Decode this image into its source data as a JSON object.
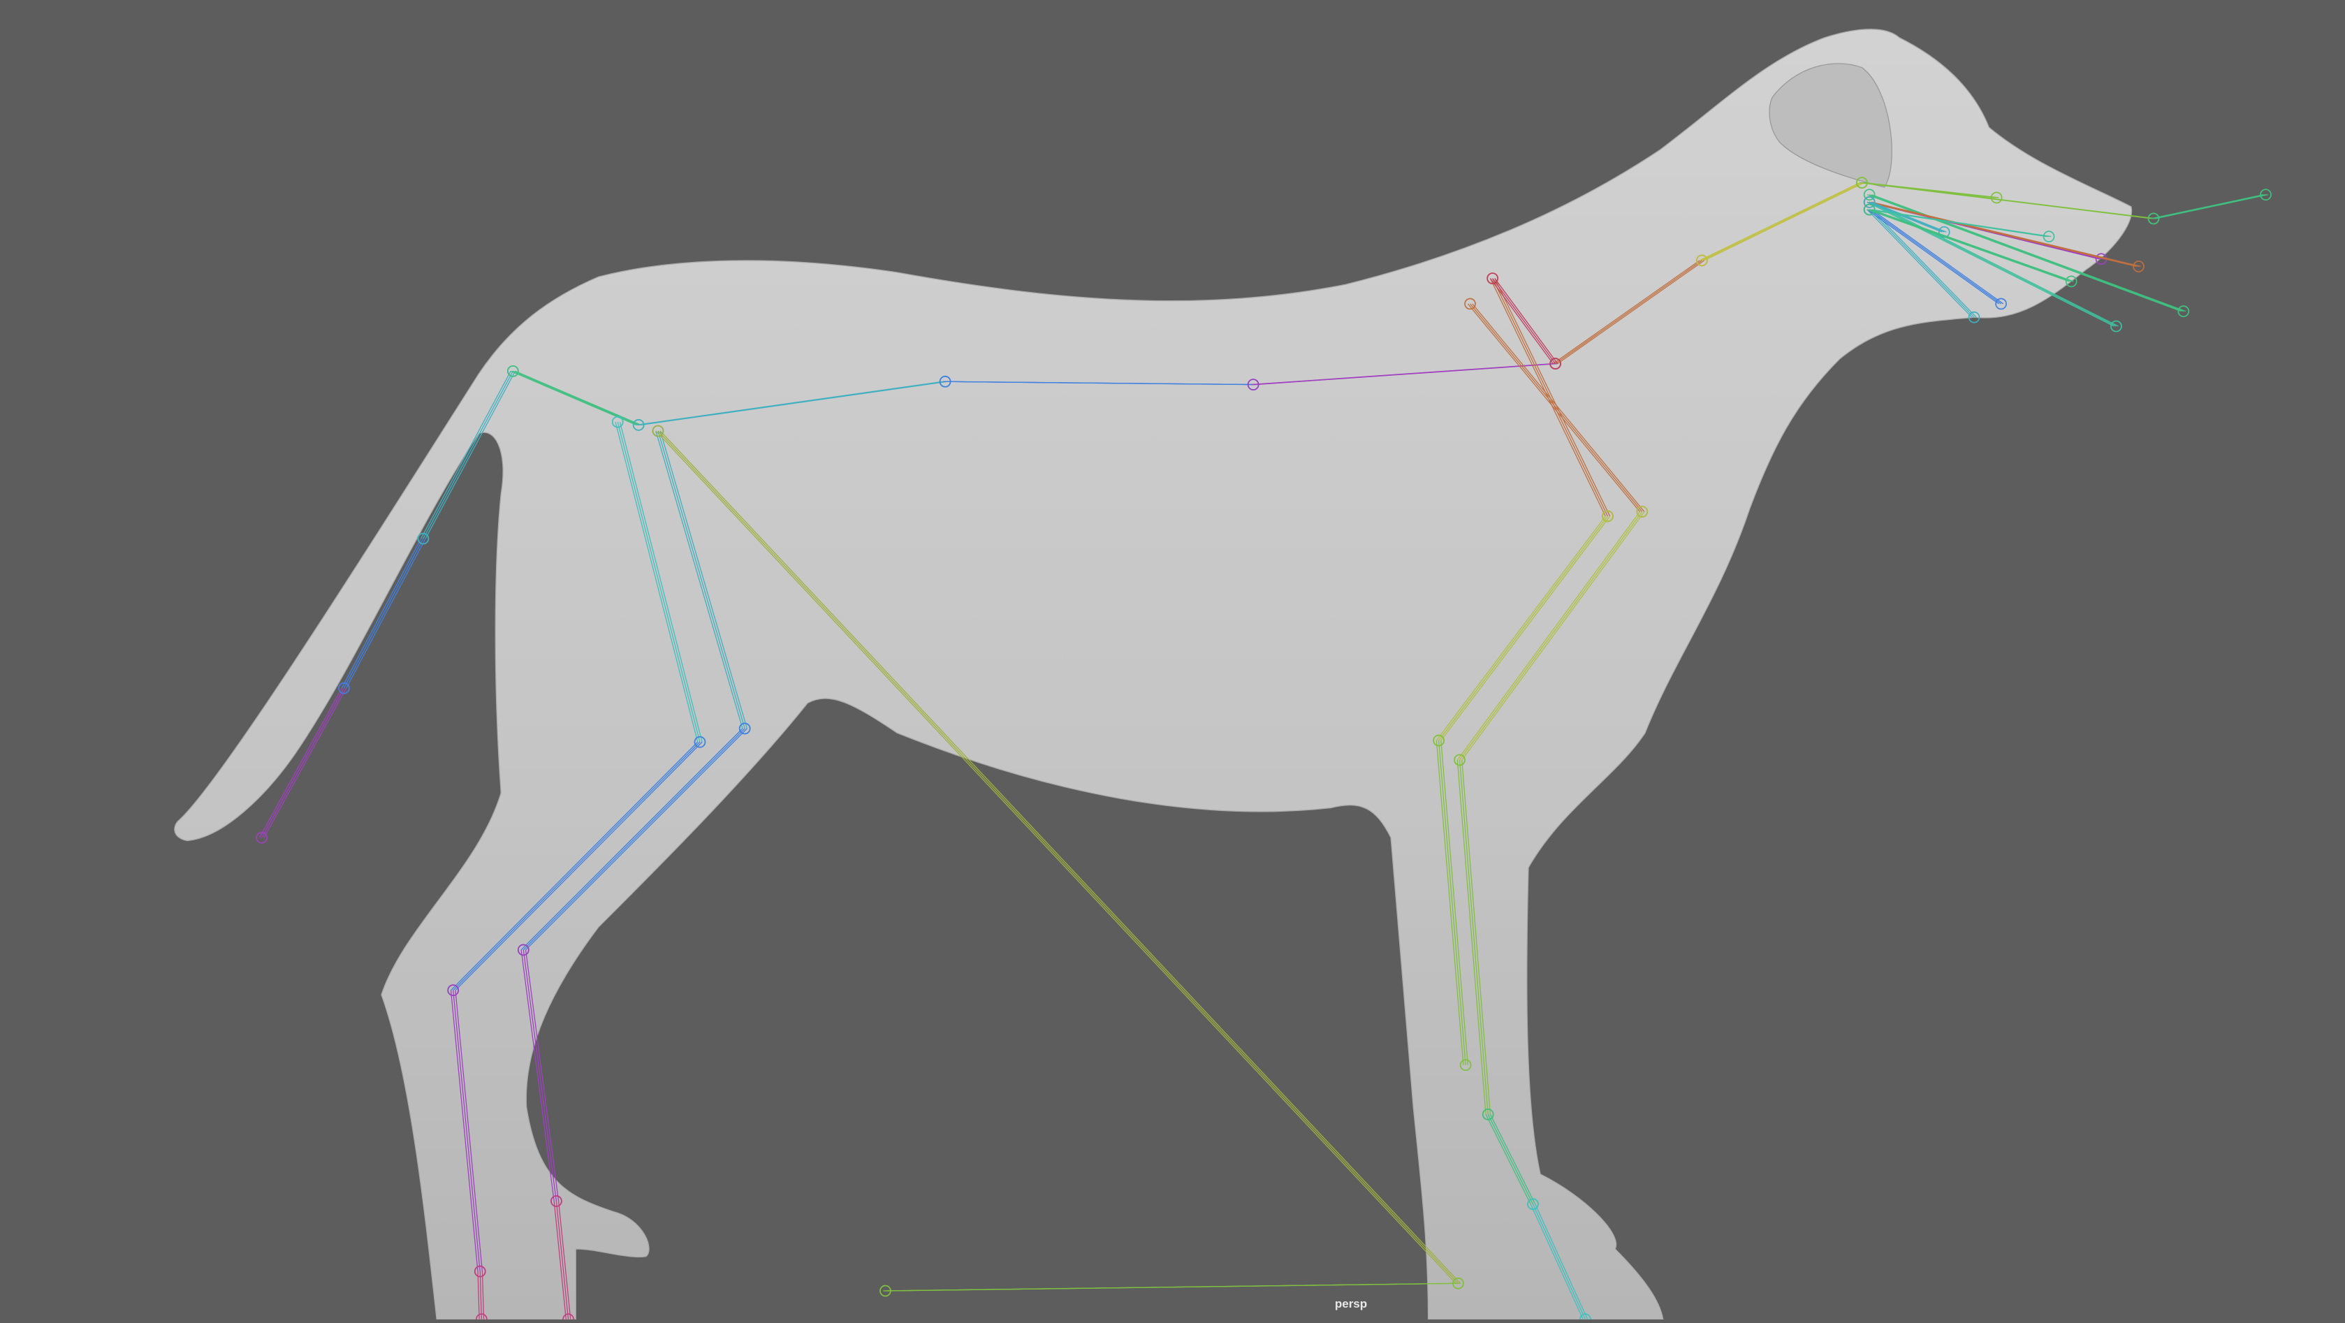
{
  "viewport": {
    "camera_label": "persp",
    "background_color": "#5d5d5d",
    "mesh_color": "#c8c8c8"
  }
}
